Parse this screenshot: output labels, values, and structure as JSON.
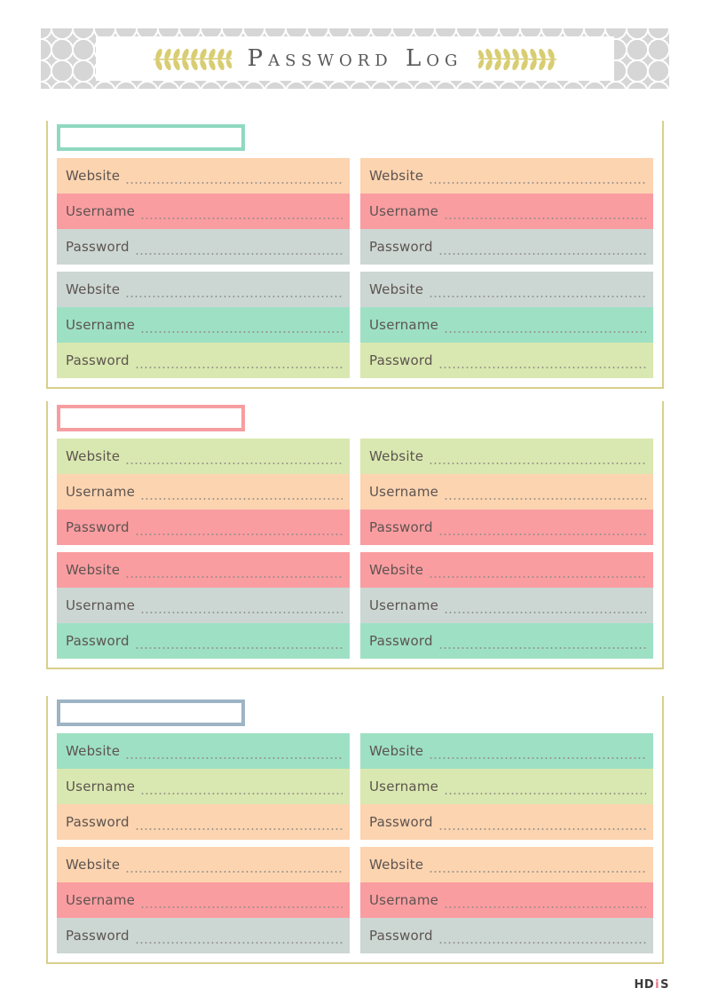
{
  "document": {
    "title": "Password Log",
    "watermark": {
      "left": "HD",
      "separator": "i",
      "right": "S"
    }
  },
  "header": {
    "title": "Password Log",
    "ornament_left": "laurel-branch-left",
    "ornament_right": "laurel-branch-right",
    "pattern": "gray-ogee-lattice",
    "pattern_color": "#d6d6d6",
    "ornament_color": "#d8cd72",
    "title_color": "#58585a"
  },
  "palette": {
    "peach": "#fcd4b0",
    "salmon": "#fa9da1",
    "bluegray": "#ccd7d4",
    "mint": "#9ee0c4",
    "lightgreen": "#d9e8b0",
    "frame": "#d9cf8a",
    "accent_mint": "#8fd9c0",
    "accent_pink": "#f79da0",
    "accent_blue": "#9cb4c4"
  },
  "labels": {
    "website": "Website",
    "username": "Username",
    "password": "Password"
  },
  "sections": [
    {
      "id": "section-1",
      "title_value": "",
      "title_placeholder": "",
      "border_color": "#8fd9c0",
      "columns": [
        {
          "groups": [
            {
              "rows": [
                {
                  "label": "Website",
                  "value": "",
                  "bg": "#fcd4b0"
                },
                {
                  "label": "Username",
                  "value": "",
                  "bg": "#fa9da1"
                },
                {
                  "label": "Password",
                  "value": "",
                  "bg": "#ccd7d4"
                }
              ]
            },
            {
              "rows": [
                {
                  "label": "Website",
                  "value": "",
                  "bg": "#ccd7d4"
                },
                {
                  "label": "Username",
                  "value": "",
                  "bg": "#9ee0c4"
                },
                {
                  "label": "Password",
                  "value": "",
                  "bg": "#d9e8b0"
                }
              ]
            }
          ]
        },
        {
          "groups": [
            {
              "rows": [
                {
                  "label": "Website",
                  "value": "",
                  "bg": "#fcd4b0"
                },
                {
                  "label": "Username",
                  "value": "",
                  "bg": "#fa9da1"
                },
                {
                  "label": "Password",
                  "value": "",
                  "bg": "#ccd7d4"
                }
              ]
            },
            {
              "rows": [
                {
                  "label": "Website",
                  "value": "",
                  "bg": "#ccd7d4"
                },
                {
                  "label": "Username",
                  "value": "",
                  "bg": "#9ee0c4"
                },
                {
                  "label": "Password",
                  "value": "",
                  "bg": "#d9e8b0"
                }
              ]
            }
          ]
        }
      ]
    },
    {
      "id": "section-2",
      "title_value": "",
      "title_placeholder": "",
      "border_color": "#f79da0",
      "columns": [
        {
          "groups": [
            {
              "rows": [
                {
                  "label": "Website",
                  "value": "",
                  "bg": "#d9e8b0"
                },
                {
                  "label": "Username",
                  "value": "",
                  "bg": "#fcd4b0"
                },
                {
                  "label": "Password",
                  "value": "",
                  "bg": "#fa9da1"
                }
              ]
            },
            {
              "rows": [
                {
                  "label": "Website",
                  "value": "",
                  "bg": "#fa9da1"
                },
                {
                  "label": "Username",
                  "value": "",
                  "bg": "#ccd7d4"
                },
                {
                  "label": "Password",
                  "value": "",
                  "bg": "#9ee0c4"
                }
              ]
            }
          ]
        },
        {
          "groups": [
            {
              "rows": [
                {
                  "label": "Website",
                  "value": "",
                  "bg": "#d9e8b0"
                },
                {
                  "label": "Username",
                  "value": "",
                  "bg": "#fcd4b0"
                },
                {
                  "label": "Password",
                  "value": "",
                  "bg": "#fa9da1"
                }
              ]
            },
            {
              "rows": [
                {
                  "label": "Website",
                  "value": "",
                  "bg": "#fa9da1"
                },
                {
                  "label": "Username",
                  "value": "",
                  "bg": "#ccd7d4"
                },
                {
                  "label": "Password",
                  "value": "",
                  "bg": "#9ee0c4"
                }
              ]
            }
          ]
        }
      ]
    },
    {
      "id": "section-3",
      "title_value": "",
      "title_placeholder": "",
      "border_color": "#9cb4c4",
      "columns": [
        {
          "groups": [
            {
              "rows": [
                {
                  "label": "Website",
                  "value": "",
                  "bg": "#9ee0c4"
                },
                {
                  "label": "Username",
                  "value": "",
                  "bg": "#d9e8b0"
                },
                {
                  "label": "Password",
                  "value": "",
                  "bg": "#fcd4b0"
                }
              ]
            },
            {
              "rows": [
                {
                  "label": "Website",
                  "value": "",
                  "bg": "#fcd4b0"
                },
                {
                  "label": "Username",
                  "value": "",
                  "bg": "#fa9da1"
                },
                {
                  "label": "Password",
                  "value": "",
                  "bg": "#ccd7d4"
                }
              ]
            }
          ]
        },
        {
          "groups": [
            {
              "rows": [
                {
                  "label": "Website",
                  "value": "",
                  "bg": "#9ee0c4"
                },
                {
                  "label": "Username",
                  "value": "",
                  "bg": "#d9e8b0"
                },
                {
                  "label": "Password",
                  "value": "",
                  "bg": "#fcd4b0"
                }
              ]
            },
            {
              "rows": [
                {
                  "label": "Website",
                  "value": "",
                  "bg": "#fcd4b0"
                },
                {
                  "label": "Username",
                  "value": "",
                  "bg": "#fa9da1"
                },
                {
                  "label": "Password",
                  "value": "",
                  "bg": "#ccd7d4"
                }
              ]
            }
          ]
        }
      ]
    }
  ]
}
